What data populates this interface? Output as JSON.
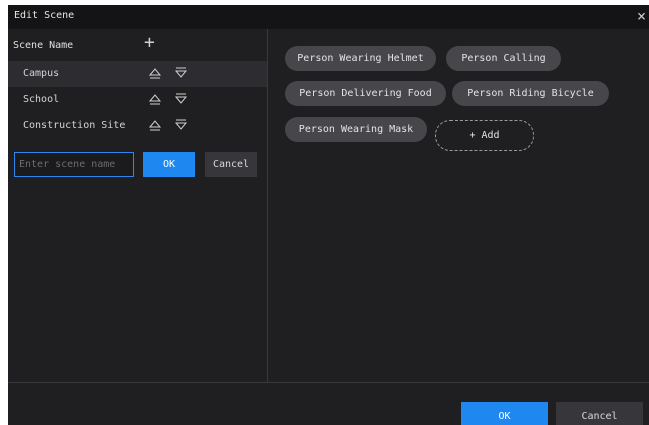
{
  "dialog": {
    "title": "Edit Scene",
    "close_icon": "×"
  },
  "scene_list": {
    "header_label": "Scene Name",
    "add_icon": "+",
    "items": [
      {
        "label": "Campus",
        "selected": true
      },
      {
        "label": "School",
        "selected": false
      },
      {
        "label": "Construction Site",
        "selected": false
      }
    ],
    "icons": {
      "move_up": "triangle-up-icon",
      "move_down": "triangle-down-icon"
    },
    "new_scene": {
      "placeholder": "Enter scene name",
      "ok_label": "OK",
      "cancel_label": "Cancel"
    }
  },
  "tags": {
    "items": [
      "Person Wearing Helmet",
      "Person Calling",
      "Person Delivering Food",
      "Person Riding Bicycle",
      "Person Wearing Mask"
    ],
    "add_label": "+ Add"
  },
  "footer": {
    "ok_label": "OK",
    "cancel_label": "Cancel"
  },
  "colors": {
    "background": "#1f1f22",
    "titlebar": "#141416",
    "accent": "#1e87f0",
    "tag": "#46464b",
    "selected_row": "#2c2c31"
  }
}
